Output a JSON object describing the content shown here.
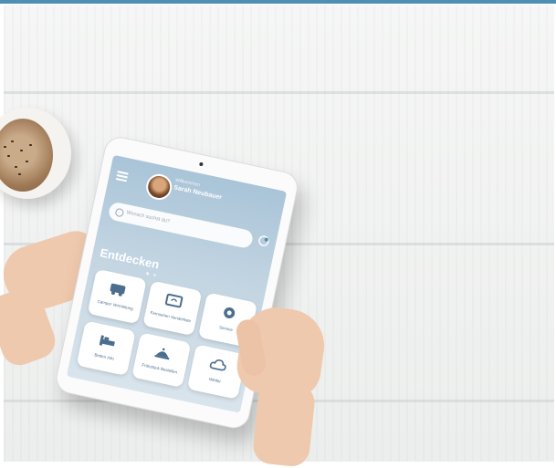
{
  "app": {
    "greeting": "Willkommen",
    "user_name": "Sarah Neubauer",
    "search_placeholder": "Wonach suchst du?",
    "section_title": "Entdecken",
    "tiles": [
      {
        "icon": "camper-van-icon",
        "label": "Camper Vermietung"
      },
      {
        "icon": "tv-icon",
        "label": "Fernsehen Senderliste"
      },
      {
        "icon": "circle-icon",
        "label": "Service"
      },
      {
        "icon": "bed-icon",
        "label": "Betten Info"
      },
      {
        "icon": "room-service-icon",
        "label": "Frühstück Bestellen"
      },
      {
        "icon": "cloud-icon",
        "label": "Wetter"
      }
    ]
  },
  "colors": {
    "accent": "#4f8fb3",
    "screen_top": "#a9c4d8",
    "tile_text": "#4b6e8e"
  }
}
